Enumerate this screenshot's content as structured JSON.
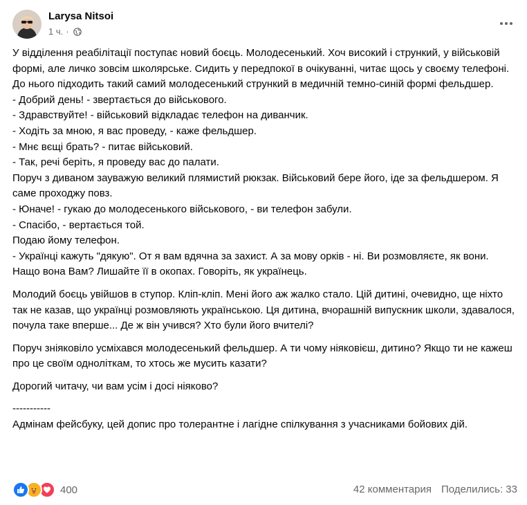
{
  "post": {
    "author": "Larysa Nitsoi",
    "time": "1 ч.",
    "separator": "·",
    "paragraphs": [
      "У відділення реабілітації поступає новий боєць. Молодесенький. Хоч високий і стрункий, у військовій формі, але личко зовсім школярське. Сидить у передпокої в очікуванні, читає щось у своєму телефоні. До нього підходить такий самий молодесенький стрункий в медичній темно-синій формі фельдшер.\n- Добрий день! - звертається до військового.\n- Здравствуйте! - військовий відкладає телефон на диванчик.\n- Ходіть за мною, я вас проведу, - каже фельдшер.\n- Мнє вєщі брать? - питає військовий.\n- Так, речі беріть, я проведу вас до палати.\nПоруч з диваном зауважую великий плямистий рюкзак. Військовий бере його, іде за фельдшером. Я саме проходжу повз.\n- Юначе! - гукаю до молодесенького військового, - ви телефон забули.\n- Спасібо, - вертається той.\nПодаю йому телефон.\n- Українці кажуть \"дякую\". От я вам вдячна за захист. А за мову орків - ні. Ви розмовляєте, як вони. Нащо вона Вам? Лишайте її в окопах. Говоріть, як українець.",
      "Молодий боєць увійшов в ступор. Кліп-кліп. Мені його аж жалко стало. Цій дитині, очевидно, ще ніхто так не казав, що українці розмовляють українською. Ця дитина, вчорашній випускник школи, здавалося, почула таке вперше... Де ж він учився? Хто були його вчителі?",
      "Поруч зніяковіло усміхався молодесенький фельдшер. А ти чому ніяковієш, дитино? Якщо ти не кажеш про це своїм одноліткам, то хтось же мусить казати?",
      "Дорогий читачу, чи вам усім і досі ніяково?",
      "-----------\nАдмінам фейсбуку, цей допис про толерантне і лагідне спілкування з учасниками бойових дій."
    ]
  },
  "footer": {
    "reaction_count": "400",
    "comments": "42 комментария",
    "shares": "Поделились: 33"
  },
  "icons": {
    "like": "like-icon",
    "care": "care-icon",
    "love": "love-icon",
    "globe": "globe-icon",
    "more": "more-options-icon"
  },
  "colors": {
    "like": "#1877f2",
    "care": "#f7b125",
    "love": "#f33e58",
    "secondary_text": "#65676b"
  }
}
